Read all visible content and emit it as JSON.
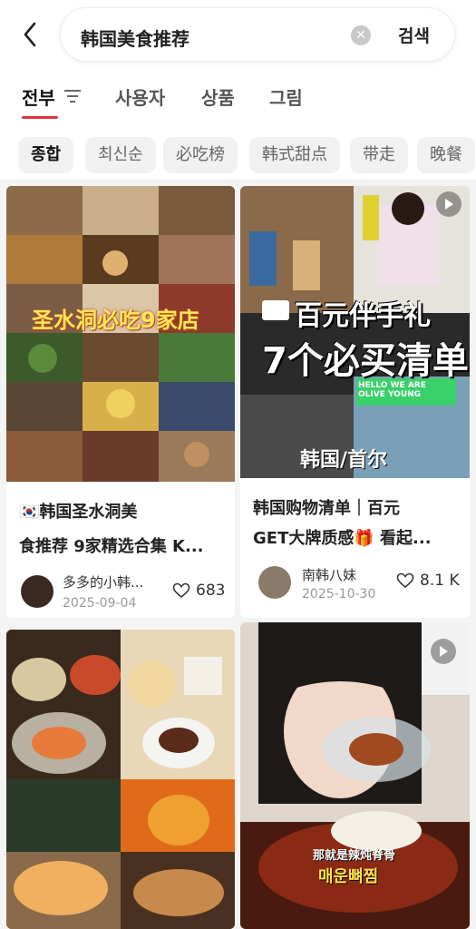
{
  "search": {
    "query": "韩国美食推荐",
    "button_label": "검색"
  },
  "tabs": [
    {
      "label": "전부"
    },
    {
      "label": "사용자"
    },
    {
      "label": "상품"
    },
    {
      "label": "그림"
    }
  ],
  "chips": [
    {
      "label": "종합"
    },
    {
      "label": "최신순"
    },
    {
      "label": "必吃榜"
    },
    {
      "label": "韩式甜点"
    },
    {
      "label": "带走"
    },
    {
      "label": "晚餐"
    }
  ],
  "cards": [
    {
      "cover_text": "圣水洞必吃9家店",
      "title_line1": "🇰🇷韩国圣水洞美",
      "title_line2": "食推荐 9家精选合集 K...",
      "author": "多多的小韩...",
      "date": "2025-09-04",
      "likes": "683"
    },
    {
      "cover_text_1": "百元伴手礼",
      "cover_text_2": "7个必买清单",
      "cover_text_3": "韩国/首尔",
      "cover_sign": "HELLO WE ARE OLIVE YOUNG",
      "title_line1": "韩国购物清单｜百元",
      "title_line2": "GET大牌质感🎁 看起...",
      "author": "南韩八妹",
      "date": "2025-10-30",
      "likes": "8.1 K"
    },
    {
      "cover_text_1": "那就是辣炖脊骨",
      "cover_text_2": "매운뼈찜"
    }
  ],
  "colors": {
    "accent": "#e3323a",
    "background": "#f4f4f4"
  }
}
